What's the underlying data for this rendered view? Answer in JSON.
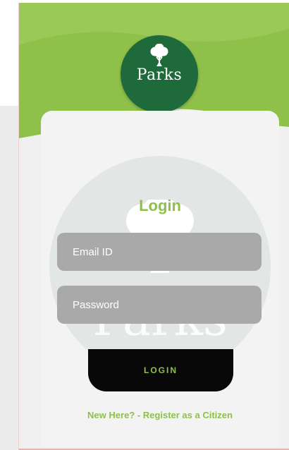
{
  "app": {
    "brand": "Parks",
    "watermark": "Parks",
    "accent_color": "#8ec04a",
    "logo_color": "#1e6a3b"
  },
  "login": {
    "title": "Login",
    "email_placeholder": "Email ID",
    "password_placeholder": "Password",
    "button_label": "LOGIN",
    "register_link": "New Here? - Register as a Citizen"
  },
  "icons": {
    "logo": "tree-icon",
    "watermark": "tree-icon"
  }
}
